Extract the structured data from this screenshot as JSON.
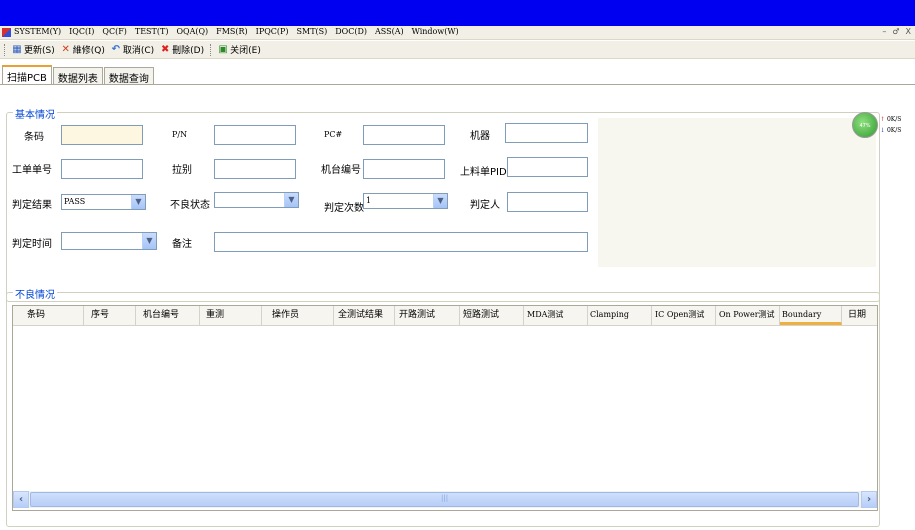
{
  "menu": {
    "items": [
      "SYSTEM(Y)",
      "IQC(I)",
      "QC(F)",
      "TEST(T)",
      "OQA(Q)",
      "FMS(R)",
      "IPQC(P)",
      "SMT(S)",
      "DOC(D)",
      "ASS(A)",
      "Window(W)"
    ],
    "controls": [
      "–",
      "♂",
      "X"
    ]
  },
  "toolbar": {
    "refresh": "更新(S)",
    "repair": "維修(Q)",
    "cancel": "取消(C)",
    "delete": "刪除(D)",
    "close": "关闭(E)"
  },
  "tabs": [
    "扫描PCB",
    "数据列表",
    "数据查询"
  ],
  "basic": {
    "title": "基本情况",
    "labels": {
      "barcode": "条码",
      "pn": "P/N",
      "pc": "PC#",
      "machine": "机器",
      "work_order": "工单单号",
      "pull": "拉别",
      "station_no": "机台编号",
      "feed_pid": "上料单PID",
      "judge_result": "判定结果",
      "defect_status": "不良状态",
      "judge_count": "判定次数",
      "judge_person": "判定人",
      "judge_time": "判定时间",
      "remark": "备注"
    },
    "values": {
      "judge_result": "PASS",
      "judge_count": "1"
    }
  },
  "defect": {
    "title": "不良情况",
    "columns": [
      "条码",
      "序号",
      "机台编号",
      "重测",
      "操作员",
      "全测试结果",
      "开路测试",
      "短路测试",
      "MDA测试",
      "Clamping",
      "IC Open测试",
      "On Power测试",
      "Boundary",
      "日期"
    ]
  },
  "net": {
    "percent": "47%",
    "up": "0K/S",
    "down": "0K/S"
  }
}
